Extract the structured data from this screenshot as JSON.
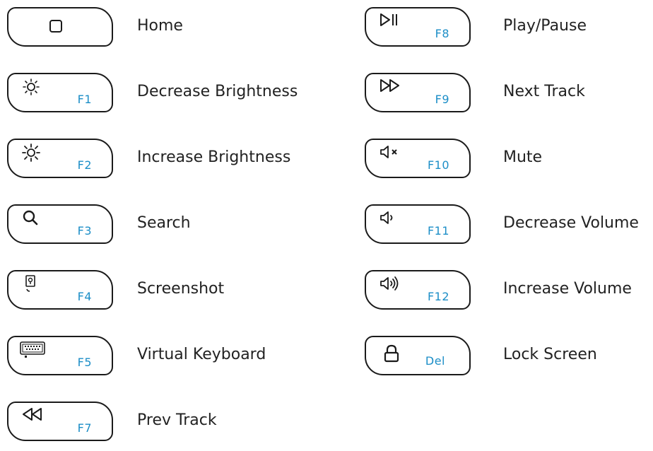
{
  "left_column": [
    {
      "icon": "home-square-icon",
      "fn": "",
      "label": "Home"
    },
    {
      "icon": "brightness-low-icon",
      "fn": "F1",
      "label": "Decrease Brightness"
    },
    {
      "icon": "brightness-high-icon",
      "fn": "F2",
      "label": "Increase Brightness"
    },
    {
      "icon": "search-icon",
      "fn": "F3",
      "label": "Search"
    },
    {
      "icon": "screenshot-icon",
      "fn": "F4",
      "label": "Screenshot"
    },
    {
      "icon": "keyboard-icon",
      "fn": "F5",
      "label": "Virtual Keyboard"
    },
    {
      "icon": "prev-track-icon",
      "fn": "F7",
      "label": "Prev Track"
    }
  ],
  "right_column": [
    {
      "icon": "play-pause-icon",
      "fn": "F8",
      "label": "Play/Pause"
    },
    {
      "icon": "next-track-icon",
      "fn": "F9",
      "label": "Next Track"
    },
    {
      "icon": "mute-icon",
      "fn": "F10",
      "label": "Mute"
    },
    {
      "icon": "volume-down-icon",
      "fn": "F11",
      "label": "Decrease Volume"
    },
    {
      "icon": "volume-up-icon",
      "fn": "F12",
      "label": "Increase Volume"
    },
    {
      "icon": "lock-icon",
      "fn": "Del",
      "label": "Lock Screen"
    }
  ],
  "colors": {
    "fn_label": "#1c8ec7",
    "text": "#222222",
    "outline": "#1a1a1a"
  }
}
